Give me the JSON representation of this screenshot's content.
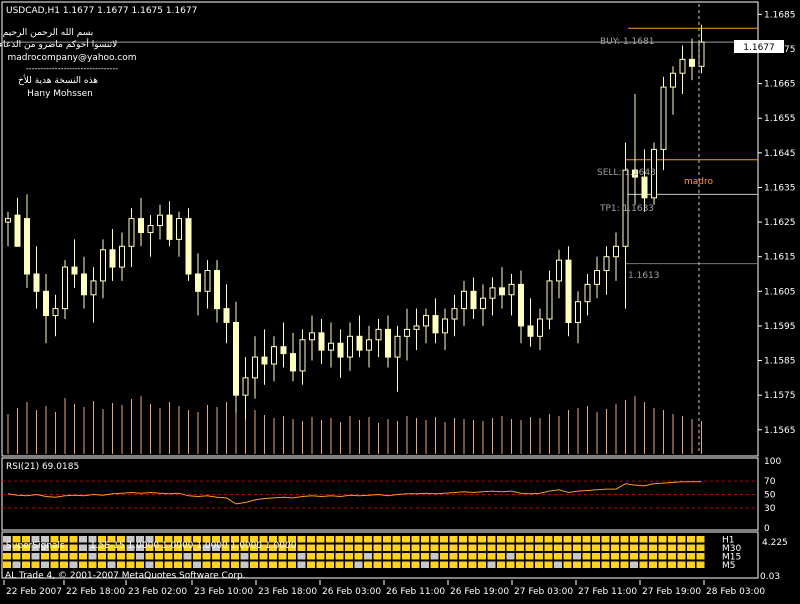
{
  "chart_data": [
    {
      "type": "candlestick",
      "title": "USDCAD,H1  1.1677 1.1677 1.1675 1.1677",
      "header_lines": [
        "بسم الله الرحمن الرحيم",
        "لاتنسوا أخوكم ماضرو من الدعاء",
        "madrocompany@yahoo.com",
        "--------------------------------",
        "هذه النسخة هدية للأخ",
        "Hany Mohssen"
      ],
      "ylim": [
        1.1558,
        1.1688
      ],
      "y_ticks": [
        "1.1685",
        "1.1675",
        "1.1665",
        "1.1655",
        "1.1645",
        "1.1635",
        "1.1625",
        "1.1615",
        "1.1605",
        "1.1595",
        "1.1585",
        "1.1575",
        "1.1565"
      ],
      "current_price": "1.1677",
      "levels": [
        {
          "label": "BUY: 1.1681",
          "value": 1.1681,
          "color": "#ff9a1c"
        },
        {
          "label": "SELL: 1.1643",
          "value": 1.1643,
          "color": "#ff9a1c"
        },
        {
          "label": "TP1: 1.1633",
          "value": 1.1633,
          "color": "#c8c8c8"
        },
        {
          "label": "1.1613",
          "value": 1.1613,
          "color": "#7a7a7a"
        }
      ],
      "annotation": "madro",
      "candles": [
        [
          1.1625,
          1.1628,
          1.1618,
          1.1626
        ],
        [
          1.1627,
          1.1632,
          1.162,
          1.1618
        ],
        [
          1.1626,
          1.1633,
          1.1606,
          1.161
        ],
        [
          1.161,
          1.1618,
          1.16,
          1.1605
        ],
        [
          1.1605,
          1.161,
          1.159,
          1.1598
        ],
        [
          1.1598,
          1.1604,
          1.1592,
          1.16
        ],
        [
          1.16,
          1.1614,
          1.1597,
          1.1612
        ],
        [
          1.1612,
          1.162,
          1.1606,
          1.161
        ],
        [
          1.161,
          1.1615,
          1.16,
          1.1604
        ],
        [
          1.1604,
          1.1612,
          1.1596,
          1.1608
        ],
        [
          1.1608,
          1.162,
          1.1603,
          1.1617
        ],
        [
          1.1617,
          1.1623,
          1.1608,
          1.1612
        ],
        [
          1.1612,
          1.1622,
          1.1608,
          1.1618
        ],
        [
          1.1618,
          1.1629,
          1.1612,
          1.1626
        ],
        [
          1.1626,
          1.1632,
          1.1618,
          1.1622
        ],
        [
          1.1622,
          1.1627,
          1.1615,
          1.1624
        ],
        [
          1.1624,
          1.163,
          1.162,
          1.1627
        ],
        [
          1.1627,
          1.1631,
          1.1618,
          1.162
        ],
        [
          1.162,
          1.1628,
          1.1615,
          1.1626
        ],
        [
          1.1626,
          1.1629,
          1.1608,
          1.161
        ],
        [
          1.161,
          1.1616,
          1.1598,
          1.1605
        ],
        [
          1.1605,
          1.1614,
          1.16,
          1.1611
        ],
        [
          1.1611,
          1.1614,
          1.1596,
          1.16
        ],
        [
          1.16,
          1.1607,
          1.159,
          1.1596
        ],
        [
          1.1596,
          1.1602,
          1.157,
          1.1575
        ],
        [
          1.1575,
          1.1586,
          1.1568,
          1.158
        ],
        [
          1.158,
          1.1592,
          1.1574,
          1.1586
        ],
        [
          1.1586,
          1.1594,
          1.1578,
          1.1584
        ],
        [
          1.1584,
          1.1592,
          1.1579,
          1.1589
        ],
        [
          1.1589,
          1.1596,
          1.1583,
          1.1587
        ],
        [
          1.1587,
          1.1593,
          1.1579,
          1.1582
        ],
        [
          1.1582,
          1.1594,
          1.1578,
          1.1591
        ],
        [
          1.1591,
          1.1598,
          1.1585,
          1.1593
        ],
        [
          1.1593,
          1.1597,
          1.1584,
          1.1588
        ],
        [
          1.1588,
          1.1596,
          1.1583,
          1.159
        ],
        [
          1.159,
          1.1594,
          1.158,
          1.1586
        ],
        [
          1.1586,
          1.1596,
          1.1582,
          1.1592
        ],
        [
          1.1592,
          1.1598,
          1.1586,
          1.1588
        ],
        [
          1.1588,
          1.1595,
          1.1583,
          1.1591
        ],
        [
          1.1591,
          1.1597,
          1.1586,
          1.1594
        ],
        [
          1.1594,
          1.1598,
          1.1583,
          1.1586
        ],
        [
          1.1586,
          1.1595,
          1.1576,
          1.1592
        ],
        [
          1.1592,
          1.16,
          1.1585,
          1.1594
        ],
        [
          1.1594,
          1.16,
          1.1588,
          1.1595
        ],
        [
          1.1595,
          1.16,
          1.159,
          1.1598
        ],
        [
          1.1598,
          1.1603,
          1.159,
          1.1593
        ],
        [
          1.1593,
          1.16,
          1.1588,
          1.1597
        ],
        [
          1.1597,
          1.1604,
          1.1592,
          1.16
        ],
        [
          1.16,
          1.1608,
          1.1595,
          1.1605
        ],
        [
          1.1605,
          1.1609,
          1.1597,
          1.16
        ],
        [
          1.16,
          1.1607,
          1.1595,
          1.1603
        ],
        [
          1.1603,
          1.1609,
          1.1598,
          1.1606
        ],
        [
          1.1606,
          1.1612,
          1.16,
          1.1604
        ],
        [
          1.1604,
          1.161,
          1.1598,
          1.1607
        ],
        [
          1.1607,
          1.1611,
          1.159,
          1.1595
        ],
        [
          1.1595,
          1.1603,
          1.1589,
          1.1592
        ],
        [
          1.1592,
          1.16,
          1.1588,
          1.1597
        ],
        [
          1.1597,
          1.1611,
          1.1594,
          1.1608
        ],
        [
          1.1608,
          1.1617,
          1.1603,
          1.1614
        ],
        [
          1.1614,
          1.1618,
          1.1592,
          1.1596
        ],
        [
          1.1596,
          1.1605,
          1.159,
          1.1602
        ],
        [
          1.1602,
          1.161,
          1.1598,
          1.1607
        ],
        [
          1.1607,
          1.1615,
          1.1603,
          1.1611
        ],
        [
          1.1611,
          1.1618,
          1.1604,
          1.1615
        ],
        [
          1.1615,
          1.1622,
          1.1608,
          1.1618
        ],
        [
          1.1618,
          1.1648,
          1.16,
          1.164
        ],
        [
          1.164,
          1.1662,
          1.163,
          1.1638
        ],
        [
          1.1638,
          1.1646,
          1.1628,
          1.1632
        ],
        [
          1.1632,
          1.1648,
          1.163,
          1.1646
        ],
        [
          1.1646,
          1.1667,
          1.164,
          1.1664
        ],
        [
          1.1664,
          1.167,
          1.1656,
          1.1668
        ],
        [
          1.1668,
          1.1676,
          1.1662,
          1.1672
        ],
        [
          1.1672,
          1.1678,
          1.1666,
          1.167
        ],
        [
          1.167,
          1.1682,
          1.1668,
          1.1677
        ]
      ],
      "volumes": [
        40,
        46,
        52,
        44,
        48,
        42,
        56,
        50,
        47,
        53,
        45,
        51,
        49,
        55,
        58,
        50,
        46,
        52,
        48,
        44,
        42,
        49,
        47,
        52,
        60,
        50,
        44,
        39,
        36,
        38,
        35,
        33,
        37,
        34,
        36,
        32,
        38,
        34,
        37,
        31,
        35,
        33,
        38,
        36,
        34,
        37,
        32,
        36,
        35,
        34,
        33,
        36,
        38,
        35,
        34,
        37,
        36,
        40,
        38,
        44,
        46,
        48,
        42,
        45,
        50,
        54,
        58,
        52,
        46,
        44,
        40,
        38,
        35,
        33
      ],
      "x_ticks": [
        "22 Feb 2007",
        "22 Feb 18:00",
        "23 Feb 02:00",
        "23 Feb 10:00",
        "23 Feb 18:00",
        "26 Feb 03:00",
        "26 Feb 11:00",
        "26 Feb 19:00",
        "27 Feb 03:00",
        "27 Feb 11:00",
        "27 Feb 19:00",
        "28 Feb 03:00"
      ]
    },
    {
      "type": "line",
      "title": "RSI(21) 69.0185",
      "ylim": [
        0,
        100
      ],
      "y_ticks": [
        "100",
        "70",
        "50",
        "30",
        "0"
      ],
      "levels": [
        70,
        50,
        30
      ],
      "values": [
        51,
        49,
        48,
        50,
        47,
        46,
        48,
        49,
        48,
        50,
        49,
        51,
        52,
        53,
        52,
        53,
        52,
        51,
        52,
        48,
        47,
        48,
        46,
        45,
        36,
        38,
        42,
        44,
        45,
        46,
        45,
        47,
        48,
        47,
        48,
        47,
        49,
        48,
        49,
        50,
        48,
        50,
        51,
        51,
        52,
        51,
        52,
        53,
        54,
        53,
        54,
        55,
        54,
        55,
        52,
        51,
        52,
        55,
        57,
        53,
        55,
        56,
        57,
        58,
        58,
        66,
        64,
        63,
        66,
        67,
        68,
        69,
        69,
        69
      ]
    },
    {
      "type": "heatmap",
      "title": "SuperSignals",
      "value_text": "1.5E-15 1.0000 1.0000 1.0000 1.0000 1.0000",
      "rows": [
        "H1",
        "M30",
        "M15",
        "M5"
      ],
      "right_tick": "4.225",
      "pattern": [
        [
          0,
          1,
          1,
          0,
          0,
          1,
          1,
          1,
          0,
          0,
          1,
          1,
          1,
          0,
          0,
          0,
          1,
          1,
          1,
          1,
          1,
          1,
          1,
          1,
          1,
          1,
          1,
          1,
          1,
          1,
          1,
          1,
          1,
          1,
          1,
          1,
          1,
          1,
          1,
          1,
          1,
          1,
          1,
          1,
          1,
          1,
          1,
          1,
          1,
          1,
          1,
          1,
          1,
          1,
          1,
          1,
          1,
          1,
          1,
          1,
          1,
          1,
          1,
          1,
          1,
          1,
          1,
          1,
          1,
          1,
          1,
          1,
          1,
          1
        ],
        [
          0,
          1,
          1,
          0,
          0,
          1,
          1,
          1,
          0,
          0,
          1,
          1,
          1,
          0,
          0,
          1,
          1,
          1,
          1,
          1,
          1,
          0,
          0,
          1,
          1,
          1,
          1,
          1,
          1,
          1,
          1,
          1,
          1,
          1,
          1,
          1,
          1,
          1,
          1,
          1,
          1,
          1,
          1,
          1,
          1,
          1,
          1,
          1,
          1,
          1,
          1,
          1,
          1,
          1,
          1,
          1,
          1,
          1,
          1,
          1,
          1,
          1,
          1,
          1,
          1,
          1,
          1,
          1,
          1,
          1,
          1,
          1,
          1,
          1
        ],
        [
          1,
          1,
          1,
          0,
          1,
          1,
          1,
          1,
          1,
          0,
          1,
          1,
          1,
          1,
          0,
          1,
          1,
          1,
          1,
          0,
          1,
          1,
          1,
          1,
          1,
          0,
          1,
          1,
          1,
          1,
          1,
          0,
          1,
          1,
          1,
          1,
          1,
          1,
          0,
          1,
          1,
          1,
          1,
          1,
          1,
          0,
          1,
          1,
          1,
          1,
          1,
          1,
          1,
          0,
          1,
          1,
          1,
          1,
          1,
          1,
          0,
          1,
          1,
          1,
          1,
          1,
          1,
          1,
          1,
          1,
          1,
          1,
          1,
          1
        ],
        [
          1,
          0,
          1,
          1,
          0,
          1,
          1,
          0,
          1,
          1,
          1,
          0,
          1,
          1,
          1,
          0,
          1,
          1,
          1,
          1,
          0,
          1,
          1,
          1,
          1,
          0,
          1,
          1,
          1,
          1,
          1,
          0,
          1,
          1,
          1,
          1,
          1,
          0,
          1,
          1,
          1,
          1,
          1,
          1,
          0,
          1,
          1,
          1,
          1,
          1,
          1,
          0,
          1,
          1,
          1,
          1,
          1,
          1,
          0,
          1,
          1,
          1,
          1,
          1,
          1,
          1,
          0,
          1,
          1,
          1,
          1,
          1,
          1,
          1
        ]
      ]
    }
  ],
  "footer": {
    "copyright": "AL Trade 4, © 2001-2007 MetaQuotes Software Corp.",
    "axis_end": "0.03"
  },
  "colors": {
    "background": "#000000",
    "candle": "#ffffc0",
    "volume": "#e8a878",
    "level_orange": "#ff9a1c",
    "rsi_line": "#ff9a1c",
    "rsi_level": "#c00000",
    "signal_on": "#ffd21f",
    "signal_off": "#c8c8c8"
  }
}
